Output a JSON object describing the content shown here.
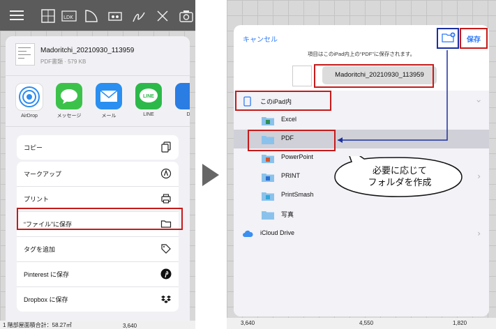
{
  "left": {
    "share_sheet": {
      "file_name": "Madoritchi_20210930_113959",
      "file_meta": "PDF書類 · 579 KB",
      "apps": [
        {
          "label": "AirDrop",
          "icon": "airdrop-icon",
          "color": "#2d8cf0"
        },
        {
          "label": "メッセージ",
          "icon": "messages-icon",
          "color": "#3cc24a"
        },
        {
          "label": "メール",
          "icon": "mail-icon",
          "color": "#2a8ff0"
        },
        {
          "label": "LINE",
          "icon": "line-icon",
          "color": "#2cb94a"
        },
        {
          "label": "D",
          "icon": "dropbox-app-icon",
          "color": "#2a7de2"
        }
      ],
      "line_icon_text": "LINE",
      "copy_label": "コピー",
      "actions": [
        {
          "label": "マークアップ",
          "icon": "markup-icon"
        },
        {
          "label": "プリント",
          "icon": "printer-icon"
        },
        {
          "label": "“ファイル”に保存",
          "icon": "folder-icon"
        },
        {
          "label": "タグを追加",
          "icon": "tag-icon"
        },
        {
          "label": "Pinterest に保存",
          "icon": "pinterest-icon"
        },
        {
          "label": "Dropbox に保存",
          "icon": "dropbox-icon"
        }
      ]
    },
    "bottom": {
      "text": "1 階部屋面積合計：58.27㎡",
      "dim": "3,640"
    }
  },
  "right": {
    "dialog": {
      "cancel_label": "キャンセル",
      "save_label": "保存",
      "save_message": "項目はこのiPad内上の“PDF”に保存されます。",
      "file_name": "Madoritchi_20210930_113959",
      "location_label": "このiPad内",
      "folders": [
        {
          "label": "Excel",
          "color": "#2f8f52"
        },
        {
          "label": "PDF",
          "color": "#8ac2ec",
          "selected": true
        },
        {
          "label": "PowerPoint",
          "color": "#d2562b"
        },
        {
          "label": "PRINT",
          "color": "#2a6ed6",
          "has_chevron": true
        },
        {
          "label": "PrintSmash",
          "color": "#35a7d8"
        },
        {
          "label": "写真",
          "color": "#8ac2ec"
        }
      ],
      "icloud_label": "iCloud Drive"
    },
    "callout": {
      "line1": "必要に応じて",
      "line2": "フォルダを作成"
    },
    "bottom_dims": [
      "3,640",
      "4,550",
      "1,820"
    ]
  },
  "colors": {
    "highlight_red": "#c61a1a",
    "highlight_blue": "#1a2fa0",
    "ios_blue": "#2f7bf6"
  }
}
